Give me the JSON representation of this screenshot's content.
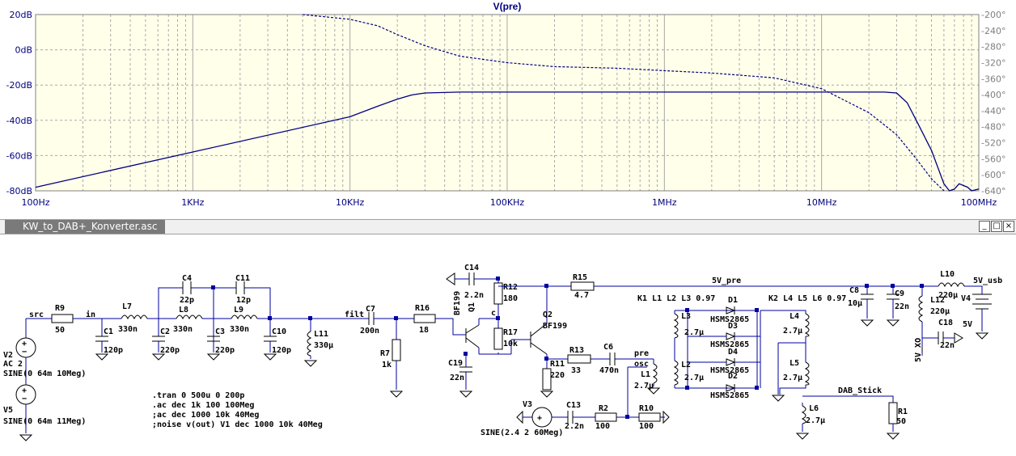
{
  "plot": {
    "title": "V(pre)",
    "x_ticks": [
      "100Hz",
      "1KHz",
      "10KHz",
      "100KHz",
      "1MHz",
      "10MHz",
      "100MHz"
    ],
    "y_left_ticks": [
      "20dB",
      "0dB",
      "-20dB",
      "-40dB",
      "-60dB",
      "-80dB"
    ],
    "y_right_ticks": [
      "-200°",
      "-240°",
      "-280°",
      "-320°",
      "-360°",
      "-400°",
      "-440°",
      "-480°",
      "-520°",
      "-560°",
      "-600°",
      "-640°"
    ],
    "colors": {
      "trace": "#000080",
      "grid": "#a8a8a8",
      "axis_text": "#000080",
      "phase_text": "#7f7f7f",
      "bg": "#ffffea"
    }
  },
  "chart_data": {
    "type": "line",
    "title": "V(pre)",
    "x_scale": "log",
    "xlim": [
      100,
      100000000
    ],
    "ylim_left": [
      -80,
      20
    ],
    "ylim_right": [
      -640,
      -200
    ],
    "series": [
      {
        "axis": "magnitude_dB",
        "style": "solid",
        "x": [
          100,
          1000,
          10000,
          15000,
          20000,
          25000,
          30000,
          50000,
          100000,
          1000000,
          10000000,
          20000000,
          25000000,
          30000000,
          35000000,
          40000000,
          50000000,
          60000000,
          65000000,
          70000000,
          75000000,
          85000000,
          90000000,
          100000000
        ],
        "y": [
          -78,
          -58,
          -38,
          -32,
          -28,
          -25.5,
          -24.5,
          -24,
          -24,
          -24,
          -24,
          -24,
          -24,
          -24.5,
          -30,
          -40,
          -57,
          -76,
          -80,
          -79,
          -76,
          -78,
          -80,
          -79
        ]
      },
      {
        "axis": "phase_deg",
        "style": "dashed",
        "x": [
          5000,
          10000,
          15000,
          20000,
          30000,
          50000,
          100000,
          200000,
          500000,
          1000000,
          2000000,
          5000000,
          10000000,
          20000000,
          30000000,
          40000000,
          50000000,
          60000000
        ],
        "y": [
          -200,
          -212,
          -228,
          -250,
          -278,
          -304,
          -320,
          -330,
          -334,
          -340,
          -346,
          -358,
          -385,
          -445,
          -500,
          -560,
          -610,
          -640
        ]
      }
    ]
  },
  "window": {
    "title": "KW_to_DAB+_Konverter.asc",
    "minimize": "_",
    "maximize": "□",
    "close": "×"
  },
  "schematic": {
    "net_labels": {
      "src": "src",
      "in": "in",
      "filt": "filt",
      "c": "c",
      "pre": "pre",
      "osc": "osc",
      "v5_pre": "5V_pre",
      "v5_usb": "5V_usb",
      "v5_xo": "5V_XO",
      "dab": "DAB_Stick"
    },
    "parts": {
      "R9": [
        "R9",
        "50"
      ],
      "L7": [
        "L7",
        "330n"
      ],
      "C1": [
        "C1",
        "120p"
      ],
      "C4": [
        "C4",
        "22p"
      ],
      "C2": [
        "C2",
        "220p"
      ],
      "L8": [
        "L8",
        "330n"
      ],
      "C11": [
        "C11",
        "12p"
      ],
      "C3": [
        "C3",
        "220p"
      ],
      "L9": [
        "L9",
        "330n"
      ],
      "C10": [
        "C10",
        "120p"
      ],
      "L11": [
        "L11",
        "330µ"
      ],
      "C7": [
        "C7",
        "200n"
      ],
      "R7": [
        "R7",
        "1k"
      ],
      "R16": [
        "R16",
        "18"
      ],
      "Q1": [
        "Q1",
        "BF199"
      ],
      "C14": [
        "C14",
        "2.2n"
      ],
      "R12": [
        "R12",
        "180"
      ],
      "R17": [
        "R17",
        "10k"
      ],
      "C19": [
        "C19",
        "22n"
      ],
      "Q2": [
        "Q2",
        "BF199"
      ],
      "R15": [
        "R15",
        "4.7"
      ],
      "R13": [
        "R13",
        "33"
      ],
      "C6": [
        "C6",
        "470n"
      ],
      "R11": [
        "R11",
        "220"
      ],
      "V3": [
        "V3",
        "SINE(2.4 2 60Meg)"
      ],
      "C13": [
        "C13",
        "2.2n"
      ],
      "R2": [
        "R2",
        "100"
      ],
      "R10": [
        "R10",
        "100"
      ],
      "L1": [
        "L1",
        "2.7µ"
      ],
      "L2": [
        "L2",
        "2.7µ"
      ],
      "L3": [
        "L3",
        "2.7µ"
      ],
      "D1": [
        "D1",
        "HSMS2865"
      ],
      "D3": [
        "D3",
        "HSMS2865"
      ],
      "D4": [
        "D4",
        "HSMS2865"
      ],
      "D2": [
        "D2",
        "HSMS2865"
      ],
      "L4": [
        "L4",
        "2.7µ"
      ],
      "L5": [
        "L5",
        "2.7µ"
      ],
      "L6": [
        "L6",
        "2.7µ"
      ],
      "R1": [
        "R1",
        "50"
      ],
      "C8": [
        "C8",
        "10µ"
      ],
      "C9": [
        "C9",
        "22n"
      ],
      "L10": [
        "L10",
        "220µ"
      ],
      "L12": [
        "L12",
        "220µ"
      ],
      "C18": [
        "C18",
        "22n"
      ],
      "V4": [
        "V4",
        "5V"
      ],
      "V2": [
        "V2",
        "AC 2"
      ],
      "V2val": "SINE(0 64m 10Meg)",
      "V5": [
        "V5",
        "SINE(0 64m 11Meg)"
      ]
    },
    "coupling": {
      "k1": "K1 L1 L2 L3 0.97",
      "k2": "K2 L4 L5 L6 0.97"
    },
    "directives": [
      ".tran 0 500u 0 200p",
      ".ac dec 1k 100 100Meg",
      ";ac dec 1000 10k 40Meg",
      ";noise v(out) V1 dec 1000 10k 40Meg"
    ]
  }
}
